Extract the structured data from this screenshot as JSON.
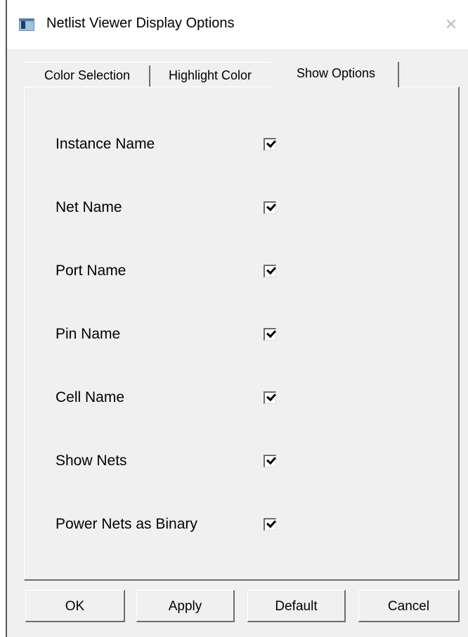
{
  "window": {
    "title": "Netlist Viewer Display Options",
    "close_glyph": "✕"
  },
  "tabs": [
    {
      "label": "Color Selection",
      "active": false
    },
    {
      "label": "Highlight Color",
      "active": false
    },
    {
      "label": "Show Options",
      "active": true
    }
  ],
  "options": [
    {
      "label": "Instance Name",
      "checked": true
    },
    {
      "label": "Net Name",
      "checked": true
    },
    {
      "label": "Port Name",
      "checked": true
    },
    {
      "label": "Pin Name",
      "checked": true
    },
    {
      "label": "Cell Name",
      "checked": true
    },
    {
      "label": "Show Nets",
      "checked": true
    },
    {
      "label": "Power Nets as Binary",
      "checked": true
    }
  ],
  "buttons": {
    "ok": "OK",
    "apply": "Apply",
    "default": "Default",
    "cancel": "Cancel"
  },
  "icons": {
    "title": "window-app-icon",
    "close": "close-icon",
    "check": "checkmark-icon"
  }
}
